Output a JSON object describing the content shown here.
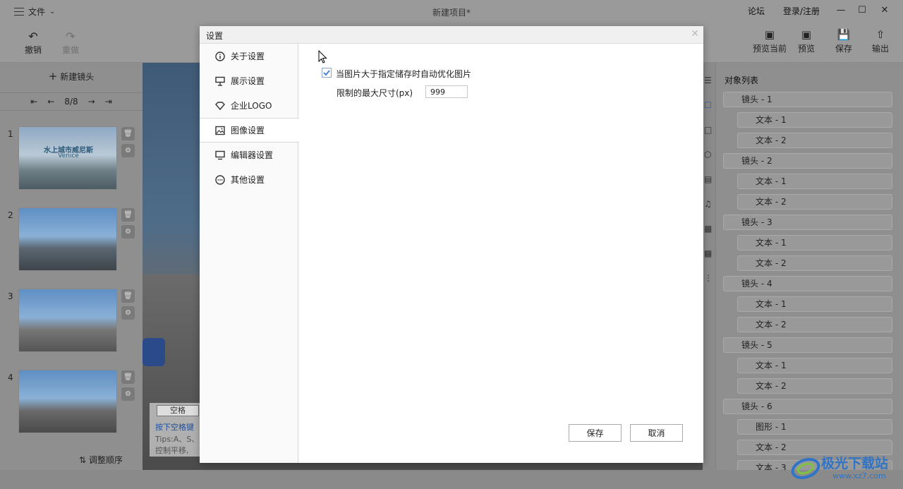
{
  "menu": {
    "label": "文件"
  },
  "window": {
    "title": "新建项目*"
  },
  "topLinks": {
    "forum": "论坛",
    "login": "登录/注册"
  },
  "toolbar": {
    "undo": "撤销",
    "redo": "重做",
    "previewCurrent": "预览当前",
    "preview": "预览",
    "save": "保存",
    "export": "输出"
  },
  "leftPanel": {
    "newShot": "新建镜头",
    "page": "8/8",
    "slides": [
      {
        "num": "1",
        "text": "水上城市威尼斯",
        "sub": "Venice"
      },
      {
        "num": "2"
      },
      {
        "num": "3"
      },
      {
        "num": "4"
      }
    ],
    "reorder": "调整顺序"
  },
  "stage": {
    "hintKey": "空格",
    "hintLine1": "按下空格键",
    "hintLine2": "Tips:A、S、",
    "hintLine3": "控制平移,"
  },
  "dialog": {
    "title": "设置",
    "nav": [
      {
        "label": "关于设置",
        "icon": "info-icon"
      },
      {
        "label": "展示设置",
        "icon": "easel-icon"
      },
      {
        "label": "企业LOGO",
        "icon": "diamond-icon"
      },
      {
        "label": "图像设置",
        "icon": "image-icon",
        "active": true
      },
      {
        "label": "编辑器设置",
        "icon": "monitor-icon"
      },
      {
        "label": "其他设置",
        "icon": "more-icon"
      }
    ],
    "optimizeLabel": "当图片大于指定储存时自动优化图片",
    "optimizeChecked": true,
    "maxSizeLabel": "限制的最大尺寸(px)",
    "maxSizeValue": "999",
    "saveBtn": "保存",
    "cancelBtn": "取消"
  },
  "objectList": {
    "title": "对象列表",
    "items": [
      {
        "label": "镜头 - 1",
        "level": 0
      },
      {
        "label": "文本 - 1",
        "level": 1
      },
      {
        "label": "文本 - 2",
        "level": 1
      },
      {
        "label": "镜头 - 2",
        "level": 0
      },
      {
        "label": "文本 - 1",
        "level": 1
      },
      {
        "label": "文本 - 2",
        "level": 1
      },
      {
        "label": "镜头 - 3",
        "level": 0
      },
      {
        "label": "文本 - 1",
        "level": 1
      },
      {
        "label": "文本 - 2",
        "level": 1
      },
      {
        "label": "镜头 - 4",
        "level": 0
      },
      {
        "label": "文本 - 1",
        "level": 1
      },
      {
        "label": "文本 - 2",
        "level": 1
      },
      {
        "label": "镜头 - 5",
        "level": 0
      },
      {
        "label": "文本 - 1",
        "level": 1
      },
      {
        "label": "文本 - 2",
        "level": 1
      },
      {
        "label": "镜头 - 6",
        "level": 0
      },
      {
        "label": "图形 - 1",
        "level": 1
      },
      {
        "label": "文本 - 2",
        "level": 1
      },
      {
        "label": "文本 - 3",
        "level": 1
      }
    ]
  },
  "watermark": {
    "brand": "极光下载站",
    "url": "www.xz7.com"
  },
  "colors": {
    "accent": "#3a7bd5",
    "overlay": "#8f8f8f",
    "dialogBg": "#ffffff"
  }
}
